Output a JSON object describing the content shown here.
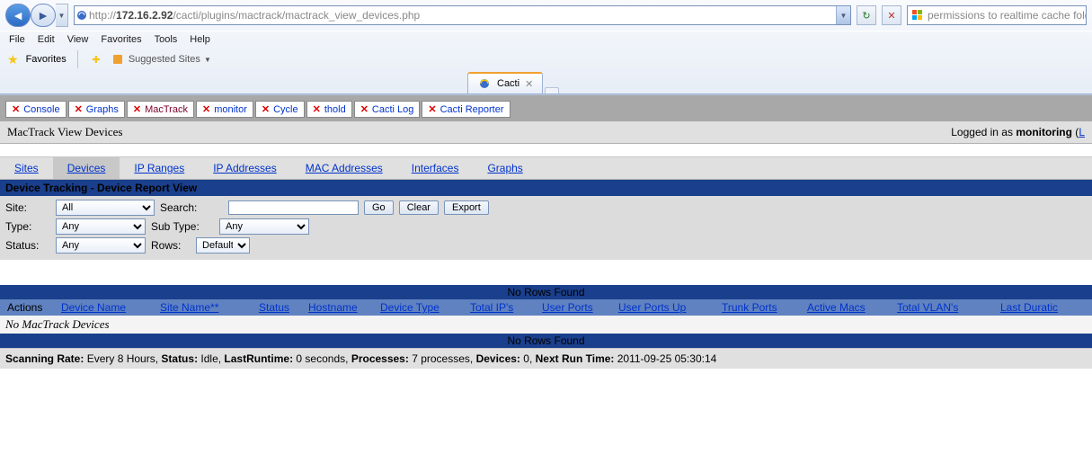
{
  "browser": {
    "url_prefix": "http://",
    "url_host": "172.16.2.92",
    "url_path": "/cacti/plugins/mactrack/mactrack_view_devices.php",
    "search_text": "permissions to realtime cache folder on ubun",
    "menu": [
      "File",
      "Edit",
      "View",
      "Favorites",
      "Tools",
      "Help"
    ],
    "favorites_label": "Favorites",
    "suggested_label": "Suggested Sites",
    "tab_title": "Cacti"
  },
  "cacti_tabs": [
    {
      "label": "Console",
      "selected": false
    },
    {
      "label": "Graphs",
      "selected": false
    },
    {
      "label": "MacTrack",
      "selected": true
    },
    {
      "label": "monitor",
      "selected": false
    },
    {
      "label": "Cycle",
      "selected": false
    },
    {
      "label": "thold",
      "selected": false
    },
    {
      "label": "Cacti Log",
      "selected": false
    },
    {
      "label": "Cacti Reporter",
      "selected": false
    }
  ],
  "page": {
    "title": "MacTrack View Devices",
    "logged_prefix": "Logged in as ",
    "logged_user": "monitoring",
    "logout_link": "L"
  },
  "subnav": [
    {
      "label": "Sites",
      "selected": false
    },
    {
      "label": "Devices",
      "selected": true
    },
    {
      "label": "IP Ranges",
      "selected": false
    },
    {
      "label": "IP Addresses",
      "selected": false
    },
    {
      "label": "MAC Addresses",
      "selected": false
    },
    {
      "label": "Interfaces",
      "selected": false
    },
    {
      "label": "Graphs",
      "selected": false
    }
  ],
  "section_title": "Device Tracking - Device Report View",
  "filter": {
    "site_label": "Site:",
    "site_value": "All",
    "search_label": "Search:",
    "search_value": "",
    "go": "Go",
    "clear": "Clear",
    "export": "Export",
    "type_label": "Type:",
    "type_value": "Any",
    "subtype_label": "Sub Type:",
    "subtype_value": "Any",
    "status_label": "Status:",
    "status_value": "Any",
    "rows_label": "Rows:",
    "rows_value": "Default"
  },
  "table": {
    "norows": "No Rows Found",
    "columns": [
      "Actions",
      "Device Name",
      "Site Name**",
      "Status",
      "Hostname",
      "Device Type",
      "Total IP's",
      "User Ports",
      "User Ports Up",
      "Trunk Ports",
      "Active Macs",
      "Total VLAN's",
      "Last Duratic"
    ],
    "empty": "No MacTrack Devices"
  },
  "status": {
    "scanning_label": "Scanning Rate:",
    "scanning_value": " Every 8 Hours, ",
    "status_label": "Status:",
    "status_value": " Idle, ",
    "lastruntime_label": "LastRuntime:",
    "lastruntime_value": " 0 seconds, ",
    "processes_label": "Processes:",
    "processes_value": " 7 processes, ",
    "devices_label": "Devices:",
    "devices_value": " 0, ",
    "nextrun_label": "Next Run Time:",
    "nextrun_value": " 2011-09-25 05:30:14"
  }
}
